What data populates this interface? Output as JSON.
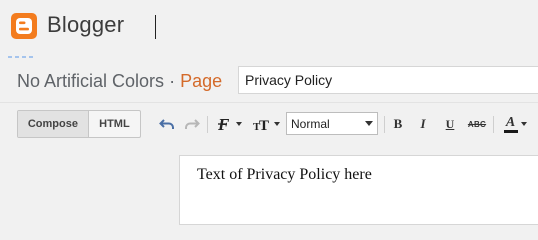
{
  "app": {
    "brand": "Blogger"
  },
  "post": {
    "blog_name": "No Artificial Colors",
    "separator": "·",
    "type_label": "Page",
    "title_value": "Privacy Policy"
  },
  "mode_tabs": [
    {
      "label": "Compose",
      "selected": true
    },
    {
      "label": "HTML",
      "selected": false
    }
  ],
  "toolbar": {
    "font_size_value": "Normal",
    "bold_label": "B",
    "italic_label": "I",
    "underline_label": "U",
    "strikethrough_label": "ABC",
    "text_color_label": "A",
    "icons": [
      "undo-icon",
      "redo-icon",
      "font-family-icon",
      "font-size-icon",
      "text-color-icon"
    ]
  },
  "editor": {
    "body_text": "Text of Privacy Policy here"
  },
  "colors": {
    "brand_orange": "#f37c1e",
    "page_word": "#d46a2a",
    "text_color_underline": "#1a1a1a"
  }
}
